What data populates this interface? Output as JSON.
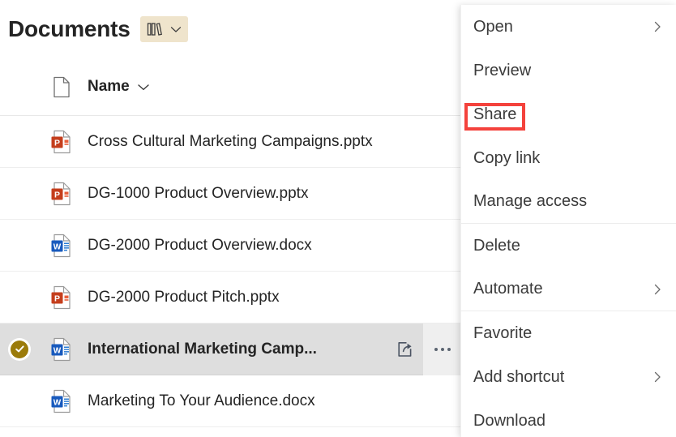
{
  "header": {
    "title": "Documents",
    "library_chip": {
      "icon": "books-icon",
      "chevron": "chevron-down-icon"
    }
  },
  "list": {
    "columns": {
      "icon_header": "document-icon",
      "name": "Name",
      "name_sort_chevron": "chevron-down-icon"
    },
    "rows": [
      {
        "name": "Cross Cultural Marketing Campaigns.pptx",
        "type": "pptx",
        "selected": false
      },
      {
        "name": "DG-1000 Product Overview.pptx",
        "type": "pptx",
        "selected": false
      },
      {
        "name": "DG-2000 Product Overview.docx",
        "type": "docx",
        "selected": false
      },
      {
        "name": "DG-2000 Product Pitch.pptx",
        "type": "pptx",
        "selected": false
      },
      {
        "name": "International Marketing Camp...",
        "type": "docx",
        "selected": true,
        "actions": {
          "share": "share-icon",
          "more": "more-options-icon"
        }
      },
      {
        "name": "Marketing To Your Audience.docx",
        "type": "docx",
        "selected": false
      }
    ]
  },
  "context_menu": {
    "items": [
      {
        "label": "Open",
        "submenu": true,
        "divider_after": false,
        "highlighted": false
      },
      {
        "label": "Preview",
        "submenu": false,
        "divider_after": false,
        "highlighted": false
      },
      {
        "label": "Share",
        "submenu": false,
        "divider_after": false,
        "highlighted": true
      },
      {
        "label": "Copy link",
        "submenu": false,
        "divider_after": false,
        "highlighted": false
      },
      {
        "label": "Manage access",
        "submenu": false,
        "divider_after": true,
        "highlighted": false
      },
      {
        "label": "Delete",
        "submenu": false,
        "divider_after": false,
        "highlighted": false
      },
      {
        "label": "Automate",
        "submenu": true,
        "divider_after": true,
        "highlighted": false
      },
      {
        "label": "Favorite",
        "submenu": false,
        "divider_after": false,
        "highlighted": false
      },
      {
        "label": "Add shortcut",
        "submenu": true,
        "divider_after": false,
        "highlighted": false
      },
      {
        "label": "Download",
        "submenu": false,
        "divider_after": false,
        "highlighted": false
      }
    ]
  },
  "colors": {
    "highlight_box": "#f4423c",
    "selected_row_bg": "#dedede",
    "library_chip_bg": "#efe4cc",
    "check_circle": "#9b7b0a",
    "powerpoint": "#c43e1c",
    "word": "#185abd",
    "text": "#242424"
  }
}
